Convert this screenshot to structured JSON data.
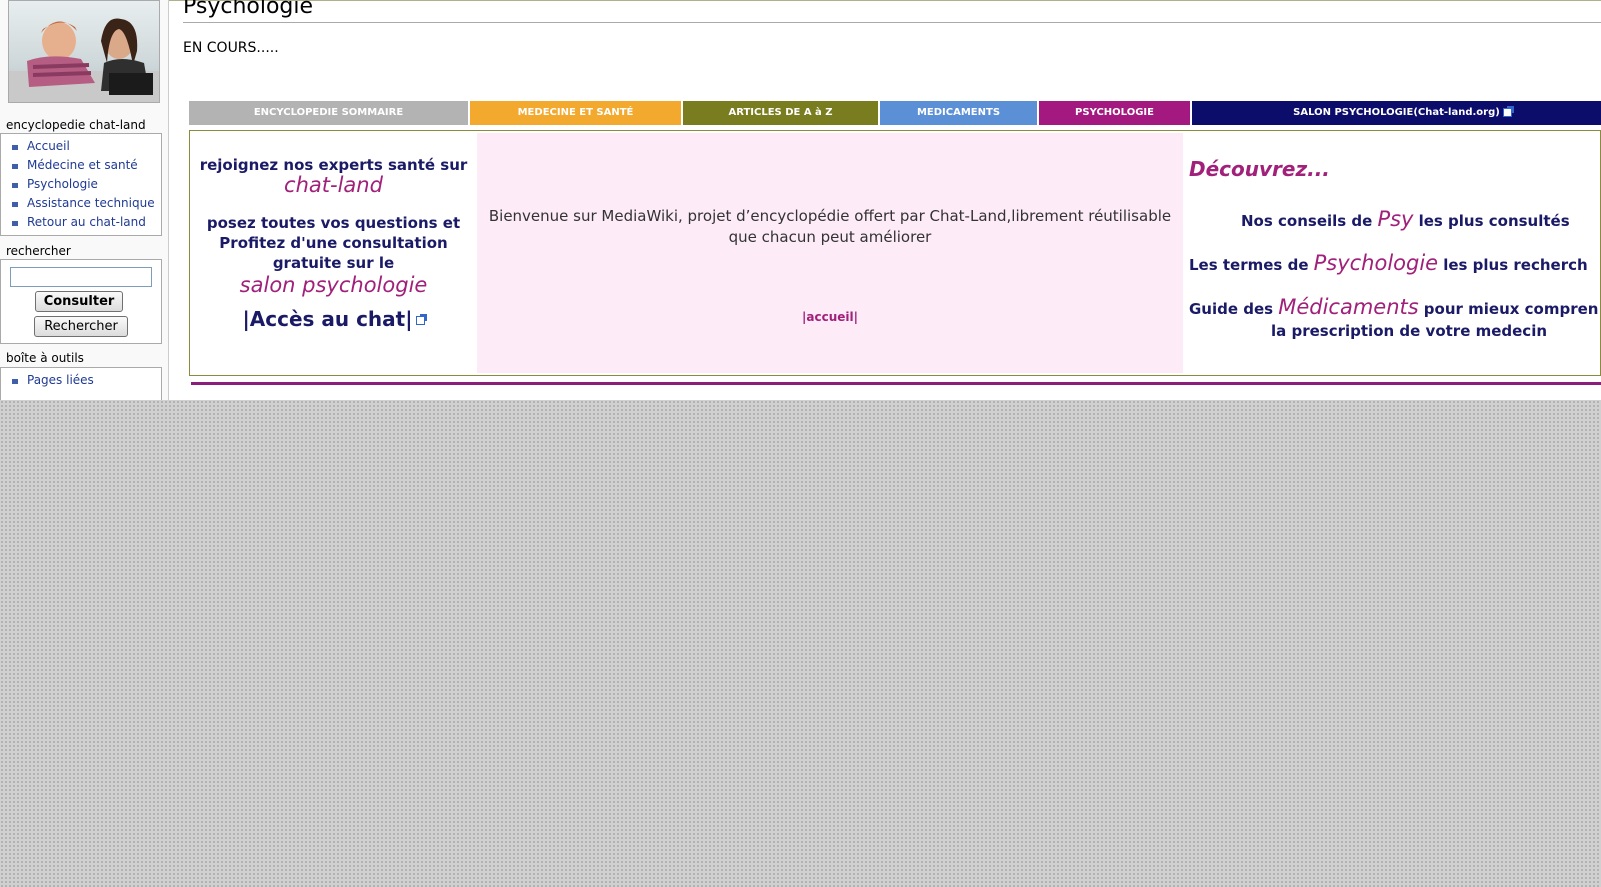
{
  "sidebar": {
    "portlet_title": "encyclopedie chat-land",
    "nav_items": [
      {
        "label": "Accueil"
      },
      {
        "label": "Médecine et santé"
      },
      {
        "label": "Psychologie"
      },
      {
        "label": "Assistance technique"
      },
      {
        "label": "Retour au chat-land"
      }
    ],
    "search_title": "rechercher",
    "search_value": "",
    "consult_button": "Consulter",
    "search_button": "Rechercher",
    "tools_title": "boîte à outils",
    "tools_items": [
      {
        "label": "Pages liées"
      }
    ]
  },
  "content": {
    "page_title": "Psychologie",
    "status_text": "EN COURS.....",
    "nav_tabs": [
      {
        "label": "ENCYCLOPEDIE SOMMAIRE",
        "color": "#b3b3b3"
      },
      {
        "label": "MEDECINE ET SANTÉ",
        "color": "#f3a92e"
      },
      {
        "label": "ARTICLES DE A à Z",
        "color": "#7a7d1f"
      },
      {
        "label": "MEDICAMENTS",
        "color": "#5b8fd6"
      },
      {
        "label": "PSYCHOLOGIE",
        "color": "#a3197f"
      },
      {
        "label": "SALON PSYCHOLOGIE(Chat-land.org)",
        "color": "#0c0c6b"
      }
    ],
    "left": {
      "join_text": "rejoignez nos experts santé sur",
      "chatland": "chat-land",
      "questions_text": "posez toutes vos questions et Profitez d'une consultation gratuite sur le",
      "salon": "salon psychologie",
      "access_link": "|Accès au chat|"
    },
    "middle": {
      "welcome": "Bienvenue sur MediaWiki, projet d’encyclopédie offert par Chat-Land,librement réutilisable que chacun peut améliorer",
      "accueil_link": "|accueil|"
    },
    "right": {
      "discover": "Découvrez...",
      "line1_pre": "Nos conseils de",
      "line1_big": "Psy",
      "line1_post": "les plus consultés",
      "line2_pre": "Les termes de",
      "line2_big": "Psychologie",
      "line2_post": "les plus recherch",
      "line3_pre": "Guide des",
      "line3_big": "Médicaments",
      "line3_post": "pour mieux compren",
      "line3_tail": "la prescription de votre medecin"
    }
  }
}
